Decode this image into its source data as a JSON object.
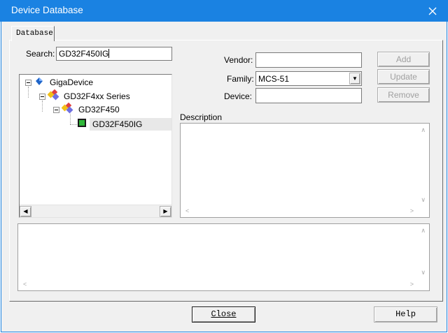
{
  "window": {
    "title": "Device Database",
    "close_glyph": "✕"
  },
  "tab": {
    "label": "Database"
  },
  "search": {
    "label": "Search:",
    "value": "GD32F450IG"
  },
  "tree": {
    "root": "GigaDevice",
    "series": "GD32F4xx Series",
    "group": "GD32F450",
    "device": "GD32F450IG"
  },
  "fields": {
    "vendor_label": "Vendor:",
    "vendor_value": "",
    "family_label": "Family:",
    "family_value": "MCS-51",
    "device_label": "Device:",
    "device_value": ""
  },
  "buttons": {
    "add": "Add",
    "update": "Update",
    "remove": "Remove",
    "close": "Close",
    "help": "Help"
  },
  "description": {
    "label": "Description",
    "text": ""
  },
  "icons": {
    "hscroll_left": "◀",
    "hscroll_right": "▶",
    "dropdown": "▼",
    "arrow_up": "∧",
    "arrow_down": "∨",
    "arrow_left": "<",
    "arrow_right": ">"
  },
  "colors": {
    "titlebar": "#1a82e2",
    "dialog_bg": "#f0f0f0",
    "selection_bg": "#e8e8e8",
    "disabled_text": "#a0a0a0"
  }
}
